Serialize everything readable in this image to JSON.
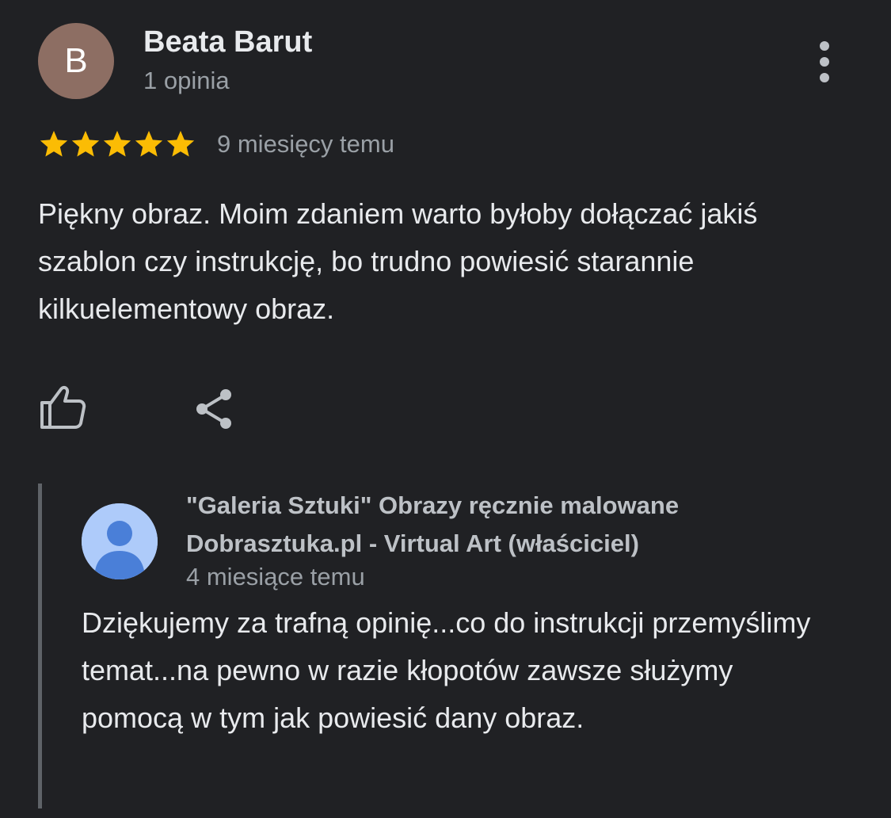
{
  "review": {
    "avatar_letter": "B",
    "avatar_color": "#8d6e63",
    "author_name": "Beata Barut",
    "author_meta": "1 opinia",
    "more_icon": "more-vert-icon",
    "rating": 5,
    "rating_max": 5,
    "star_color": "#fbbc04",
    "date": "9 miesięcy temu",
    "text": "Piękny obraz. Moim zdaniem warto byłoby dołączać jakiś szablon czy instrukcję, bo trudno powiesić starannie kilkuelementowy obraz.",
    "actions": {
      "like_icon": "thumb-up-icon",
      "share_icon": "share-icon"
    }
  },
  "owner_reply": {
    "avatar_icon": "person-icon",
    "avatar_color": "#aecbfa",
    "owner_name": "\"Galeria Sztuki\" Obrazy ręcznie malowane Dobrasztuka.pl - Virtual Art (właściciel)",
    "date": "4 miesiące temu",
    "text": "Dziękujemy za trafną opinię...co do instrukcji przemyślimy temat...na pewno w razie kłopotów zawsze służymy pomocą w tym jak powiesić dany obraz."
  }
}
